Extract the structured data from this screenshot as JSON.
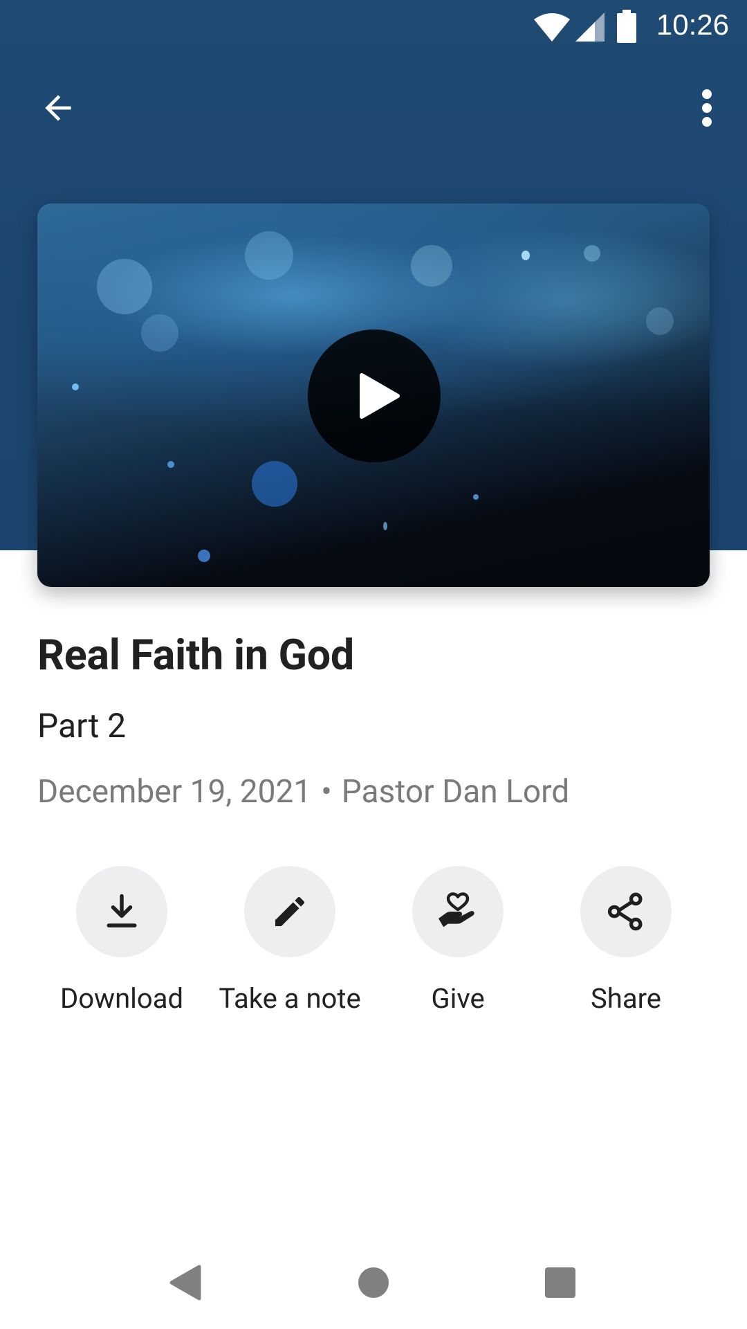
{
  "status_bar": {
    "time": "10:26",
    "icons": [
      "wifi-icon",
      "cellular-signal-icon",
      "battery-icon"
    ]
  },
  "app_bar": {
    "back_icon": "arrow-left-icon",
    "menu_icon": "more-vert-icon"
  },
  "media": {
    "play_icon": "play-icon"
  },
  "sermon": {
    "title": "Real Faith in God",
    "subtitle": "Part 2",
    "date": "December 19, 2021",
    "separator": "•",
    "speaker": "Pastor Dan Lord"
  },
  "actions": [
    {
      "label": "Download",
      "icon": "download-icon"
    },
    {
      "label": "Take a note",
      "icon": "pencil-icon"
    },
    {
      "label": "Give",
      "icon": "heart-hand-icon"
    },
    {
      "label": "Share",
      "icon": "share-icon"
    }
  ],
  "nav_bar": {
    "icons": [
      "nav-back-icon",
      "nav-home-icon",
      "nav-recents-icon"
    ]
  },
  "colors": {
    "header_bg": "#1f4a73",
    "action_circle": "#eeeef0",
    "meta_text": "#7a7a7a"
  }
}
